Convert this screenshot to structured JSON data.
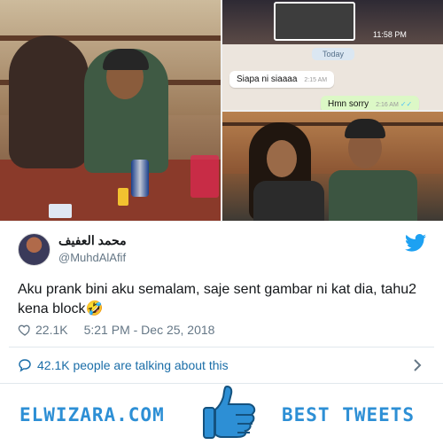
{
  "chat": {
    "status_time": "11:58 PM",
    "day_chip": "Today",
    "incoming": {
      "text": "Siapa ni siaaaa",
      "time": "2:15 AM"
    },
    "outgoing": {
      "text": "Hmn sorry",
      "time": "2:16 AM"
    }
  },
  "tweet": {
    "display_name": "محمد العفيف",
    "handle": "@MuhdAlAfif",
    "text": "Aku prank bini aku semalam, saje sent gambar ni kat dia, tahu2 kena block🤣",
    "likes": "22.1K",
    "timestamp": "5:21 PM - Dec 25, 2018",
    "talking": "42.1K people are talking about this"
  },
  "footer": {
    "site": "ELWIZARA.COM",
    "tagline": "BEST TWEETS"
  },
  "colors": {
    "accent": "#2d8fd5",
    "twitter_blue": "#1da1f2",
    "link": "#1b6ea8",
    "muted": "#657786"
  }
}
